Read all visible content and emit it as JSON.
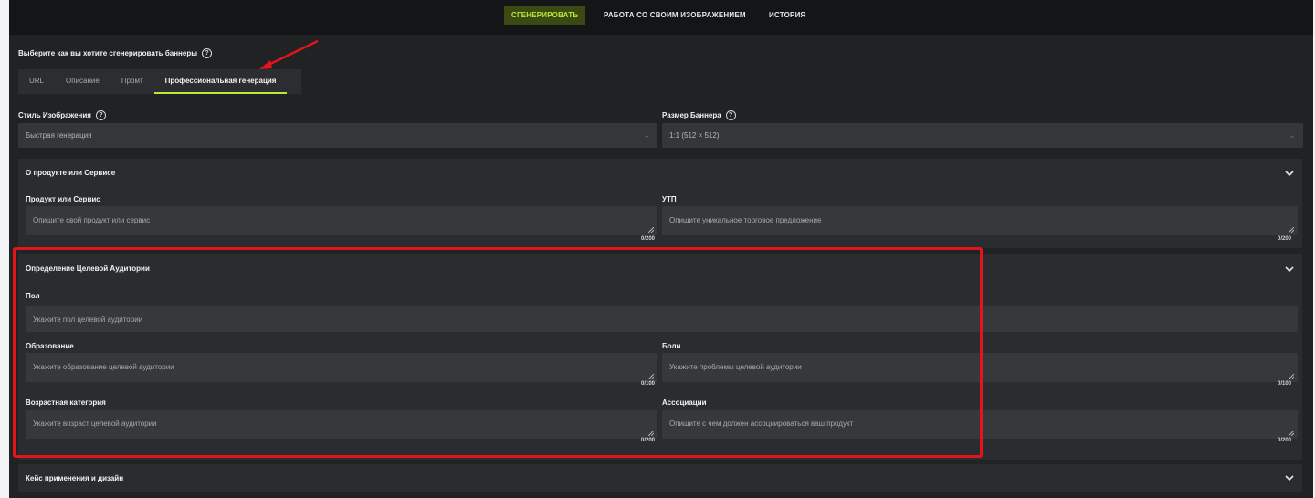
{
  "nav": {
    "generate": "СГЕНЕРИРОВАТЬ",
    "own_image": "РАБОТА СО СВОИМ ИЗОБРАЖЕНИЕМ",
    "history": "ИСТОРИЯ"
  },
  "heading": "Выберите как вы хотите сгенерировать баннеры",
  "tabs": [
    "URL",
    "Описание",
    "Промт",
    "Профессиональная генерация"
  ],
  "active_tab": "Профессиональная генерация",
  "style": {
    "label": "Стиль Изображения",
    "value": "Быстрая генерация"
  },
  "size": {
    "label": "Размер Баннера",
    "value": "1:1 (512 × 512)"
  },
  "product_section": {
    "title": "О продукте или Сервисе",
    "product": {
      "label": "Продукт или Сервис",
      "placeholder": "Опишите свой продукт или сервис",
      "counter": "0/200"
    },
    "usp": {
      "label": "УТП",
      "placeholder": "Опишите уникальное торговое предложение",
      "counter": "0/200"
    }
  },
  "audience_section": {
    "title": "Определение Целевой Аудитории",
    "gender": {
      "label": "Пол",
      "placeholder": "Укажите пол целевой аудитории"
    },
    "education": {
      "label": "Образование",
      "placeholder": "Укажите образование целевой аудитории",
      "counter": "0/100"
    },
    "pains": {
      "label": "Боли",
      "placeholder": "Укажите проблемы целевой аудитории",
      "counter": "0/100"
    },
    "age": {
      "label": "Возрастная категория",
      "placeholder": "Укажите возраст целевой аудитории",
      "counter": "0/200"
    },
    "associations": {
      "label": "Ассоциации",
      "placeholder": "Опишите с чем должен ассоциироваться ваш продукт",
      "counter": "0/200"
    }
  },
  "usecase_section": {
    "title": "Кейс применения и дизайн"
  },
  "colors": {
    "accent": "#b9ea3a",
    "highlight": "#e5141b",
    "background": "#202224"
  }
}
